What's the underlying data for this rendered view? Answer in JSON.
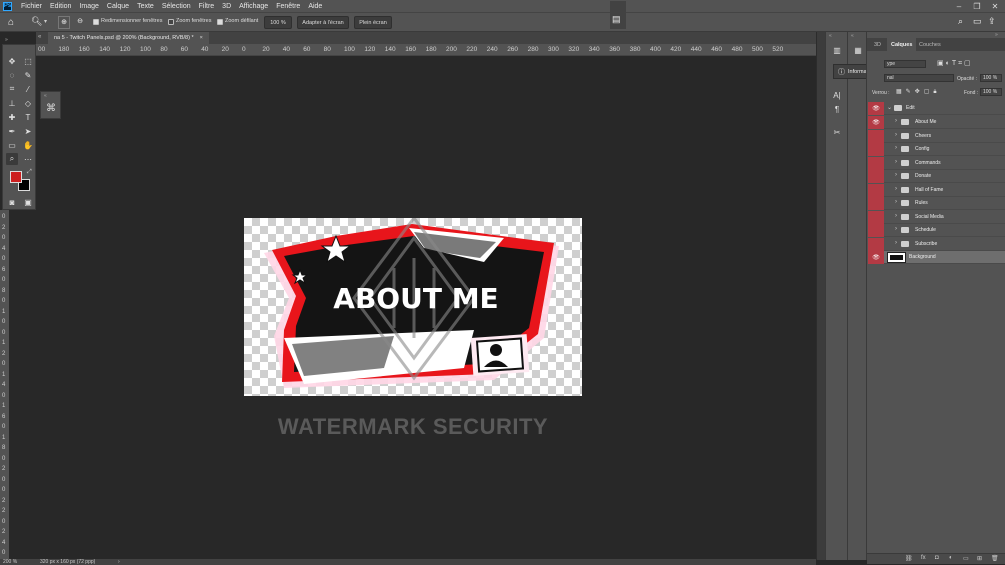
{
  "menubar": {
    "items": [
      "Fichier",
      "Edition",
      "Image",
      "Calque",
      "Texte",
      "Sélection",
      "Filtre",
      "3D",
      "Affichage",
      "Fenêtre",
      "Aide"
    ]
  },
  "options": {
    "chk_resize": "Redimensionner fenêtres",
    "chk_zoom_all": "Zoom fenêtres",
    "chk_scrubby": "Zoom défilant",
    "zoom_value": "100 %",
    "fit_screen": "Adapter à l'écran",
    "fill_screen": "Plein écran"
  },
  "document": {
    "tab_title": "na 5 - Twitch Panels.psd @ 200% (Background, RVB/8) *",
    "close": "×"
  },
  "hruler": [
    "00",
    "180",
    "160",
    "140",
    "120",
    "100",
    "80",
    "60",
    "40",
    "20",
    "0",
    "20",
    "40",
    "60",
    "80",
    "100",
    "120",
    "140",
    "160",
    "180",
    "200",
    "220",
    "240",
    "260",
    "280",
    "300",
    "320",
    "340",
    "360",
    "380",
    "400",
    "420",
    "440",
    "460",
    "480",
    "500",
    "520"
  ],
  "vruler": [
    "0",
    "2",
    "0",
    "4",
    "0",
    "6",
    "0",
    "8",
    "0",
    "1",
    "0",
    "0",
    "1",
    "2",
    "0",
    "1",
    "4",
    "0",
    "1",
    "6",
    "0",
    "1",
    "8",
    "0",
    "2",
    "0",
    "0",
    "2",
    "2",
    "0",
    "2",
    "4",
    "0"
  ],
  "canvas": {
    "heading": "ABOUT ME",
    "watermark": "WATERMARK SECURITY"
  },
  "info_flyout": "Informa...",
  "layers_panel": {
    "tabs": [
      "3D",
      "Calques",
      "Couches"
    ],
    "active_tab": "Calques",
    "kind_filter": "ype",
    "blend_mode": "nal",
    "opacity_label": "Opacité :",
    "opacity_value": "100 %",
    "lock_label": "Verrou :",
    "fill_label": "Fond :",
    "fill_value": "100 %",
    "group": "Edit",
    "folders": [
      "About Me",
      "Cheers",
      "Config",
      "Commands",
      "Donate",
      "Hall of Fame",
      "Rules",
      "Social Media",
      "Schedule",
      "Subscribe"
    ],
    "background_layer": "Background"
  },
  "status": {
    "zoom": "200 %",
    "doc_size": "320 px x 160 px (72 ppp)",
    "arrow": "›"
  },
  "colors": {
    "foreground": "#cc1f1f",
    "background": "#000000",
    "eye_column": "#b33a44"
  }
}
